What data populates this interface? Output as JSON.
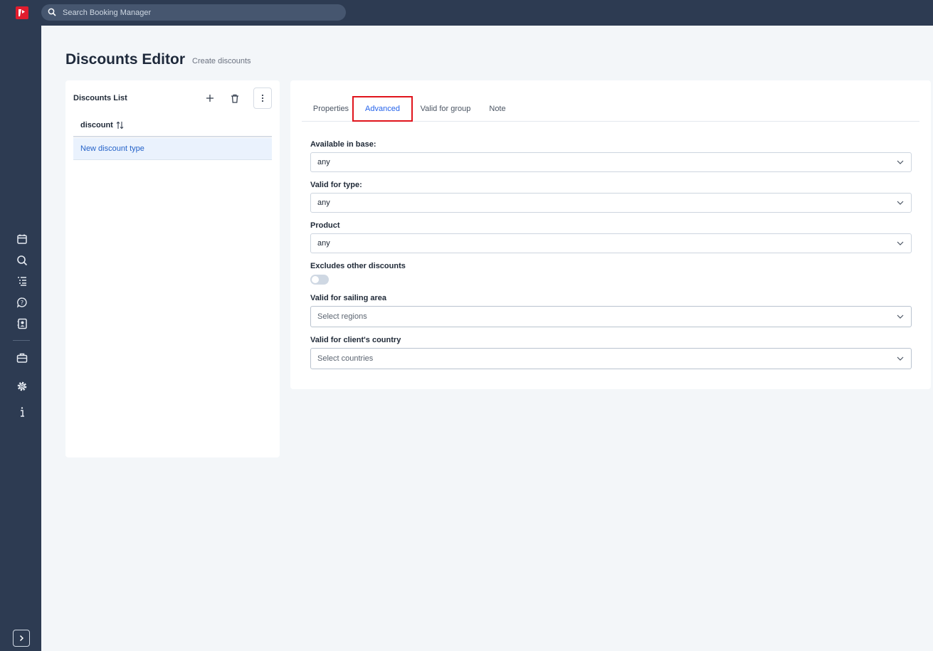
{
  "header": {
    "search_placeholder": "Search Booking Manager"
  },
  "page": {
    "title": "Discounts Editor",
    "subtitle": "Create discounts"
  },
  "list": {
    "title": "Discounts List",
    "column": "discount",
    "rows": [
      "New discount type"
    ]
  },
  "editor": {
    "tabs": [
      "Properties",
      "Advanced",
      "Valid for group",
      "Note"
    ],
    "active_tab": "Advanced",
    "fields": {
      "available_in_base": {
        "label": "Available in base:",
        "value": "any"
      },
      "valid_for_type": {
        "label": "Valid for type:",
        "value": "any"
      },
      "product": {
        "label": "Product",
        "value": "any"
      },
      "excludes_other": {
        "label": "Excludes other discounts",
        "on": false
      },
      "sailing_area": {
        "label": "Valid for sailing area",
        "placeholder": "Select regions"
      },
      "client_country": {
        "label": "Valid for client's country",
        "placeholder": "Select countries"
      }
    }
  },
  "colors": {
    "nav_bg": "#2d3b52",
    "accent": "#2563eb",
    "highlight_border": "#e0141c",
    "brand_red": "#e11d2e"
  },
  "icons": [
    "search-icon",
    "calendar-icon",
    "search-icon",
    "list-icon",
    "help-chat-icon",
    "contacts-icon",
    "briefcase-icon",
    "gear-icon",
    "info-icon",
    "chevron-right-icon",
    "plus-icon",
    "trash-icon",
    "more-vertical-icon",
    "sort-icon",
    "chevron-down-icon"
  ]
}
